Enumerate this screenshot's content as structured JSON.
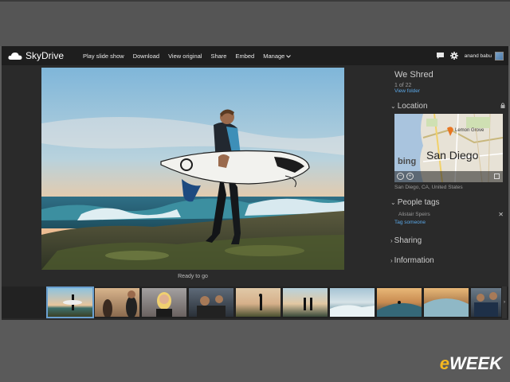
{
  "brand": {
    "name": "SkyDrive"
  },
  "menu": {
    "items": [
      "Play slide show",
      "Download",
      "View original",
      "Share",
      "Embed",
      "Manage"
    ]
  },
  "user": {
    "name": "anand babu"
  },
  "album": {
    "title": "We Shred",
    "count": "1 of 22",
    "view_folder": "View folder"
  },
  "photo": {
    "caption": "Ready to go"
  },
  "location": {
    "heading": "Location",
    "map_city": "San Diego",
    "map_place": "Lemon Grove",
    "map_brand": "bing",
    "address": "San Diego, CA, United States"
  },
  "people": {
    "heading": "People tags",
    "person": "Alistair Speirs",
    "tag_link": "Tag someone"
  },
  "sharing": {
    "heading": "Sharing"
  },
  "information": {
    "heading": "Information"
  },
  "watermark": {
    "prefix": "e",
    "rest": "WEEK"
  },
  "icons": {
    "logo": "cloud-icon",
    "chat": "chat-icon",
    "settings": "gear-icon",
    "lock": "lock-icon",
    "close": "close-icon"
  },
  "colors": {
    "accent": "#5aa7e6",
    "topbar": "#1e1e1e",
    "app_bg": "#2a2a2a",
    "brand_e": "#f5b81f"
  }
}
